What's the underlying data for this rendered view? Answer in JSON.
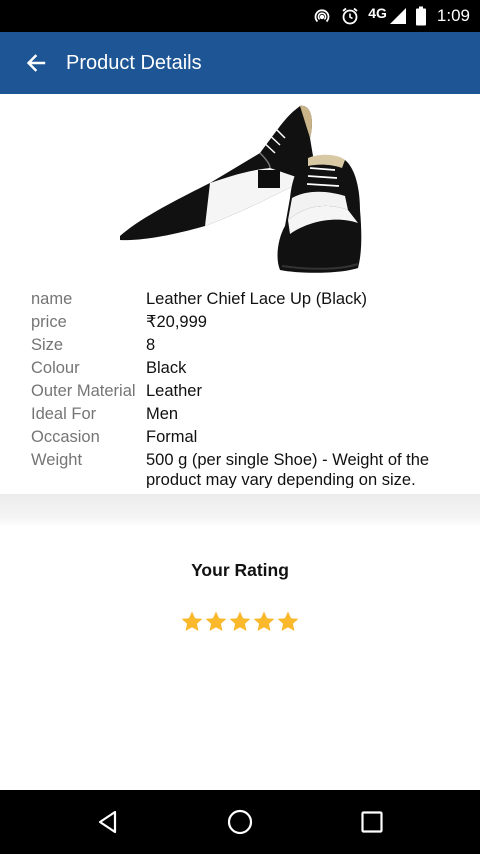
{
  "status_bar": {
    "network": "4G",
    "time": "1:09"
  },
  "header": {
    "title": "Product Details"
  },
  "product": {
    "specs": [
      {
        "label": "name",
        "value": "Leather Chief Lace Up  (Black)"
      },
      {
        "label": "price",
        "value": "₹20,999"
      },
      {
        "label": "Size",
        "value": "8"
      },
      {
        "label": "Colour",
        "value": "Black"
      },
      {
        "label": "Outer Material",
        "value": "Leather"
      },
      {
        "label": "Ideal For",
        "value": "Men"
      },
      {
        "label": "Occasion",
        "value": "Formal"
      },
      {
        "label": "Weight",
        "value": "500 g (per single Shoe) - Weight of the product may vary depending on size."
      }
    ]
  },
  "rating": {
    "title": "Your Rating",
    "value": 5,
    "max": 5,
    "star_color": "#f9b92b"
  },
  "colors": {
    "app_bar": "#1d5595",
    "status_bar": "#000000",
    "nav_bar": "#000000"
  }
}
